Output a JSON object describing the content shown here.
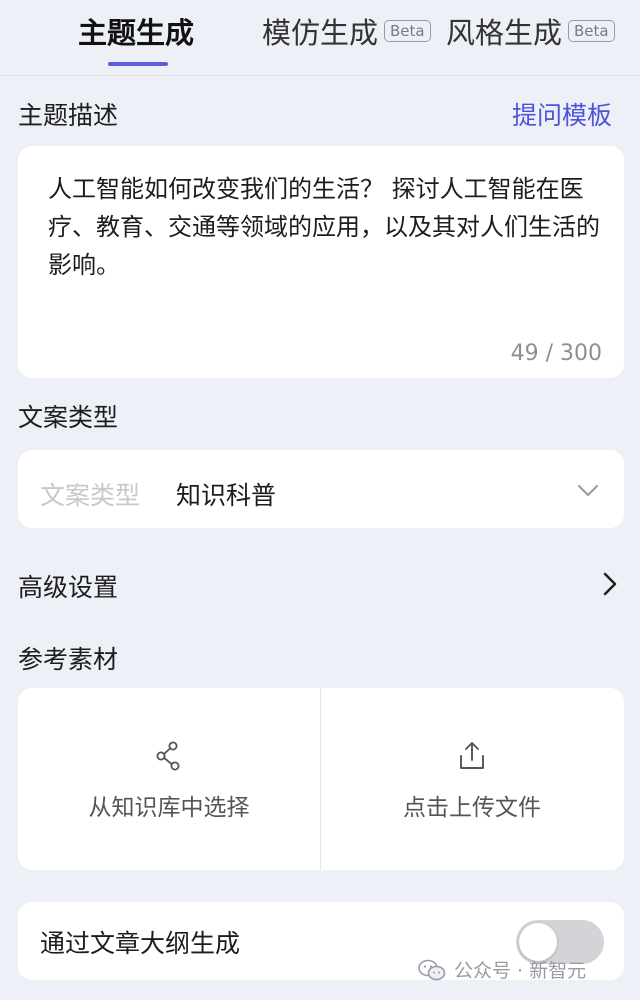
{
  "tabs": [
    {
      "label": "主题生成",
      "active": true
    },
    {
      "label": "模仿生成",
      "badge": "Beta"
    },
    {
      "label": "风格生成",
      "badge": "Beta"
    }
  ],
  "topic": {
    "label": "主题描述",
    "template_link": "提问模板",
    "text": "人工智能如何改变我们的生活？ 探讨人工智能在医疗、教育、交通等领域的应用，以及其对人们生活的影响。",
    "counter": "49 / 300"
  },
  "copy_type": {
    "label": "文案类型",
    "field_label": "文案类型",
    "value": "知识科普"
  },
  "advanced": {
    "label": "高级设置"
  },
  "reference": {
    "label": "参考素材",
    "knowledge_base": "从知识库中选择",
    "upload": "点击上传文件"
  },
  "outline": {
    "label": "通过文章大纲生成",
    "enabled": false
  },
  "watermark": "公众号 · 新智元",
  "colors": {
    "accent": "#4f53d9",
    "background": "#eef0f7"
  }
}
